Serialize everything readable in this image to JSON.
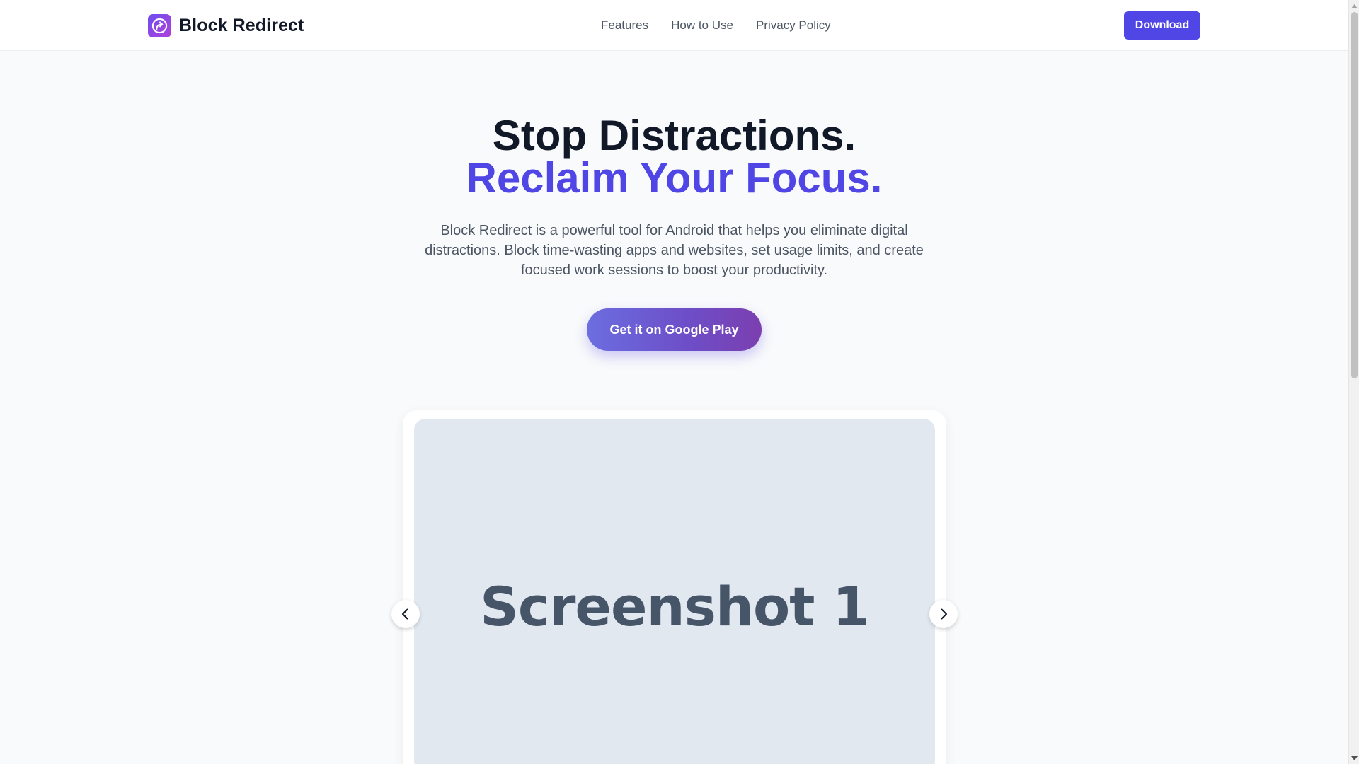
{
  "header": {
    "brand": "Block Redirect",
    "nav": [
      "Features",
      "How to Use",
      "Privacy Policy"
    ],
    "download_label": "Download"
  },
  "hero": {
    "title_line1": "Stop Distractions.",
    "title_line2": "Reclaim Your Focus.",
    "description": "Block Redirect is a powerful tool for Android that helps you eliminate digital distractions. Block time-wasting apps and websites, set usage limits, and create focused work sessions to boost your productivity.",
    "cta_label": "Get it on Google Play"
  },
  "carousel": {
    "slide_label": "Screenshot 1",
    "prev_icon": "chevron-left-icon",
    "next_icon": "chevron-right-icon"
  },
  "colors": {
    "accent": "#4f46e5",
    "heading": "#111827",
    "body_text": "#4b5563",
    "slide_bg": "#e2e8f0",
    "slide_text": "#475569",
    "page_bg": "#f9fafb"
  }
}
